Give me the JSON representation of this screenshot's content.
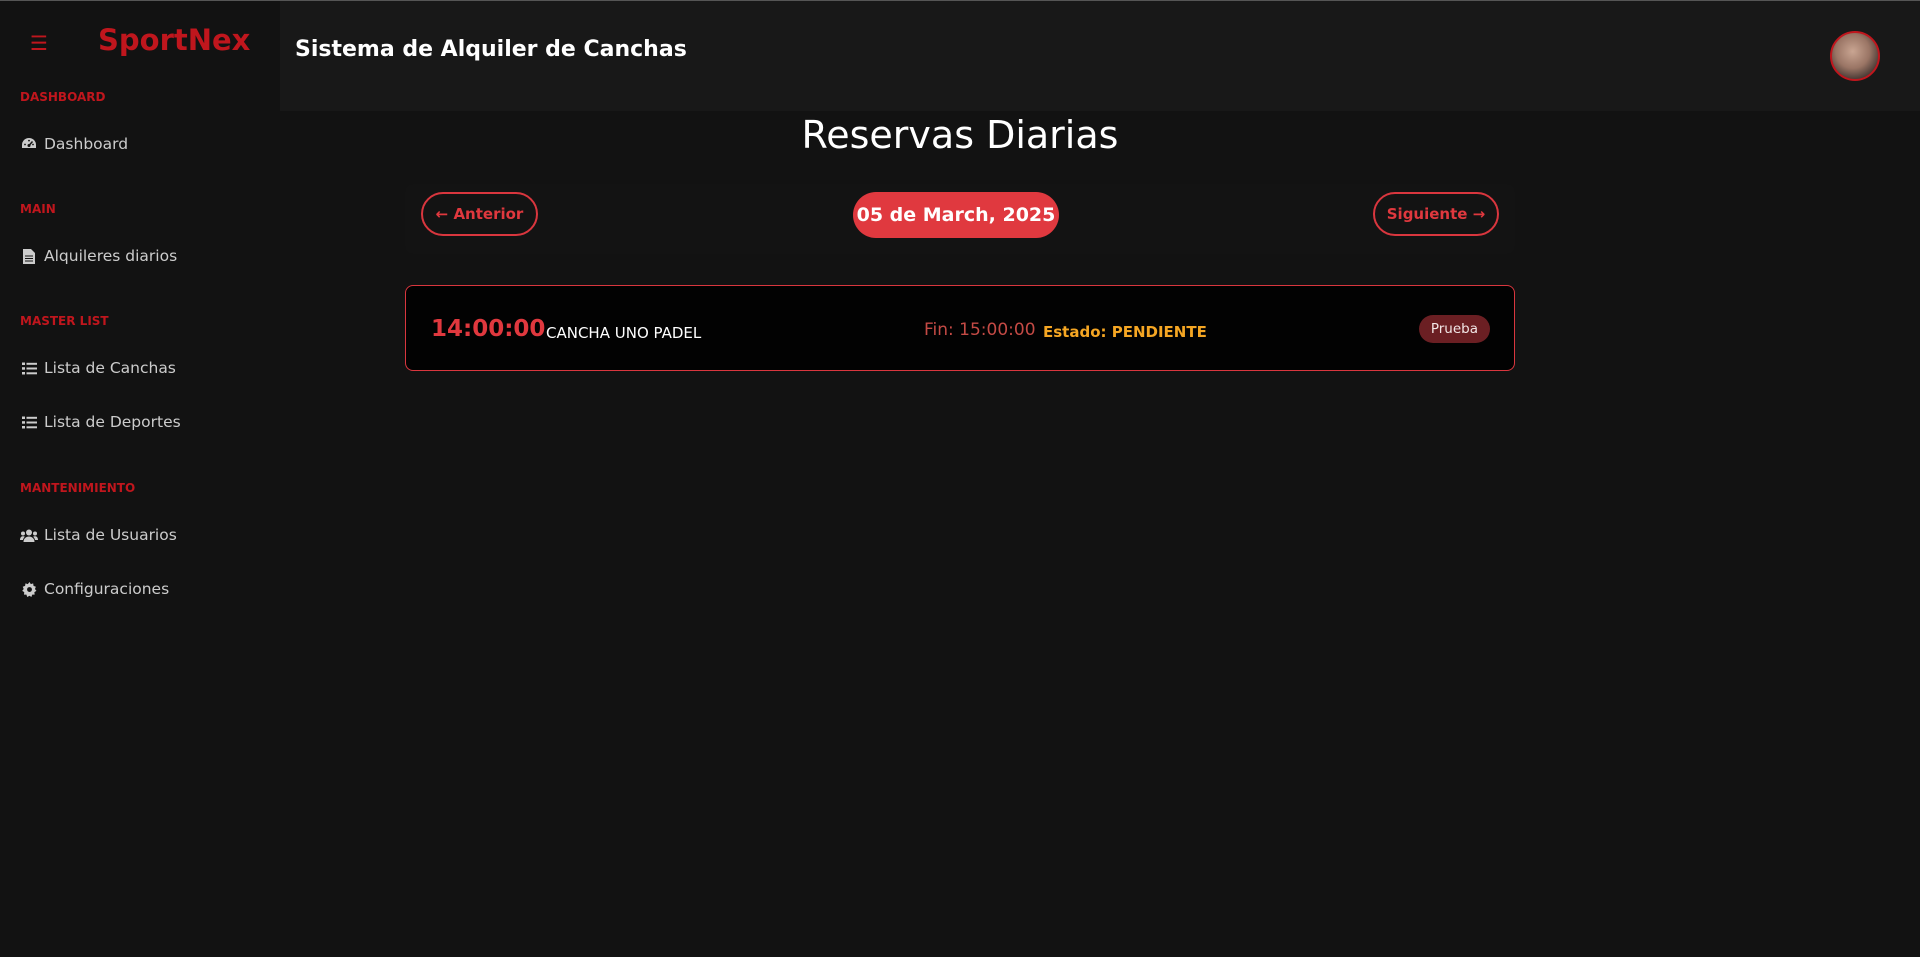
{
  "brand": {
    "name": "SportNex",
    "menu_icon": "hamburger-icon"
  },
  "sidebar": {
    "sections": [
      {
        "label": "DASHBOARD",
        "items": [
          {
            "icon": "tachometer-icon",
            "label": "Dashboard"
          }
        ]
      },
      {
        "label": "MAIN",
        "items": [
          {
            "icon": "file-icon",
            "label": "Alquileres diarios"
          }
        ]
      },
      {
        "label": "MASTER LIST",
        "items": [
          {
            "icon": "list-icon",
            "label": "Lista de Canchas"
          },
          {
            "icon": "list-icon",
            "label": "Lista de Deportes"
          }
        ]
      },
      {
        "label": "MANTENIMIENTO",
        "items": [
          {
            "icon": "users-icon",
            "label": "Lista de Usuarios"
          },
          {
            "icon": "gear-icon",
            "label": "Configuraciones"
          }
        ]
      }
    ]
  },
  "header": {
    "title": "Sistema de Alquiler de Canchas"
  },
  "main": {
    "title": "Reservas Diarias",
    "prev_label": "← Anterior",
    "next_label": "Siguiente →",
    "date": "05 de March, 2025",
    "reservations": [
      {
        "start": "14:00:00",
        "court": "CANCHA UNO PADEL",
        "end": "Fin: 15:00:00",
        "status": "Estado: PENDIENTE",
        "tag": "Prueba"
      }
    ]
  },
  "colors": {
    "accent": "#e0383e",
    "brand": "#c0161d",
    "status": "#f5a623",
    "background": "#121212"
  }
}
